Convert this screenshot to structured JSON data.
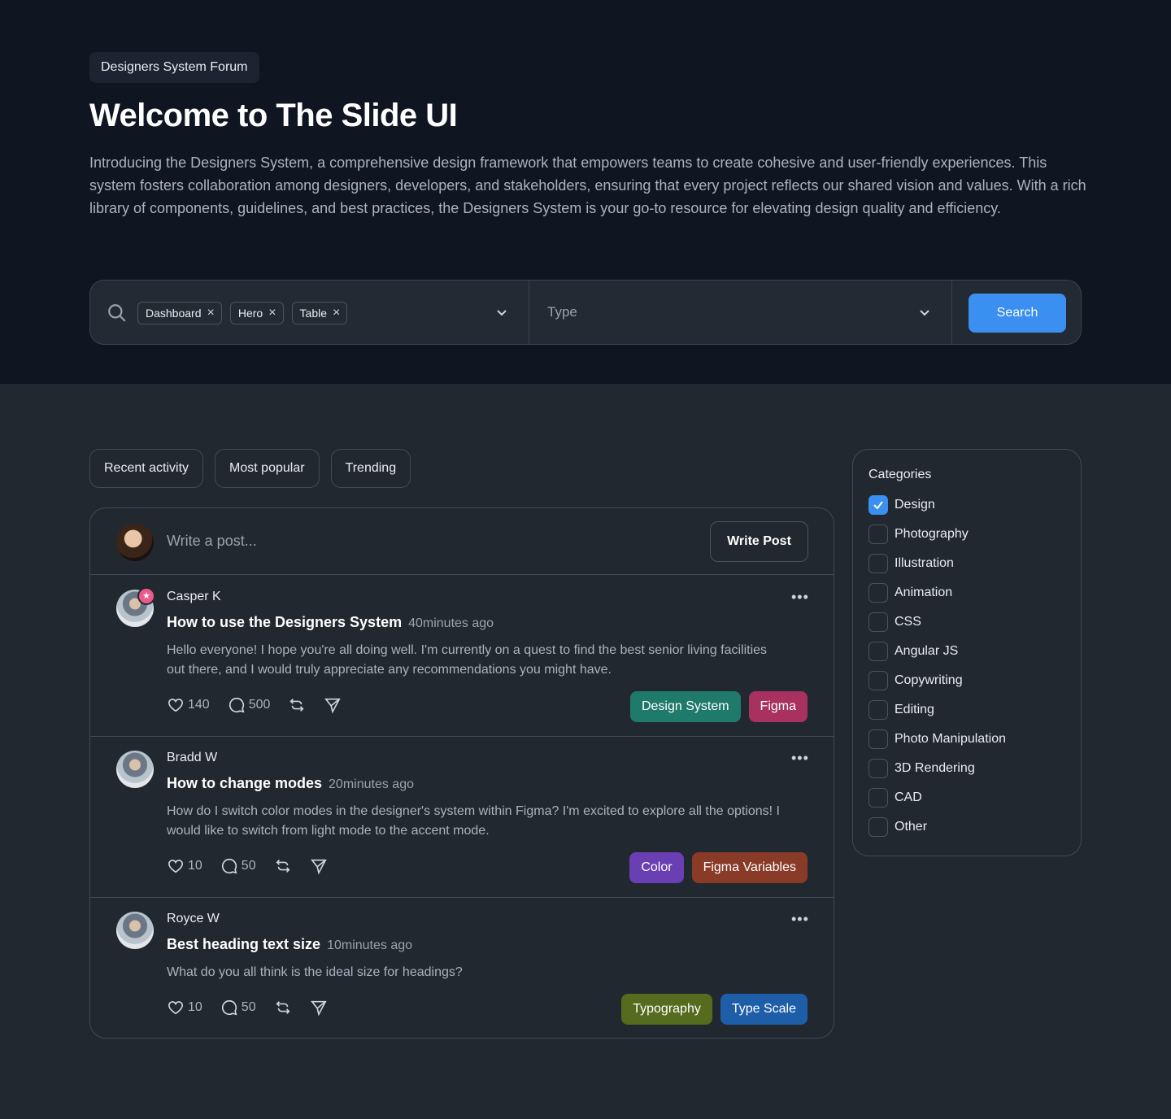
{
  "hero": {
    "pill": "Designers System Forum",
    "title": "Welcome to The Slide UI",
    "description": "Introducing the Designers System, a comprehensive design framework that empowers teams to create cohesive and user-friendly experiences. This system fosters collaboration among designers, developers, and stakeholders, ensuring that every project reflects our shared vision and values. With a rich library of components, guidelines, and best practices, the Designers System is your go-to resource for elevating design quality and efficiency."
  },
  "search": {
    "chips": [
      "Dashboard",
      "Hero",
      "Table"
    ],
    "type_placeholder": "Type",
    "button": "Search"
  },
  "tabs": [
    "Recent activity",
    "Most popular",
    "Trending"
  ],
  "composer": {
    "placeholder": "Write a post...",
    "button": "Write Post"
  },
  "posts": [
    {
      "author": "Casper K",
      "title": "How to use the Designers System",
      "time": "40minutes ago",
      "body": "Hello everyone! I hope you're all doing well. I'm currently on a quest to find the best senior living facilities out there, and I would truly appreciate any recommendations you might have.",
      "likes": "140",
      "comments": "500",
      "tags": [
        {
          "label": "Design System",
          "color": "#1f7a6b"
        },
        {
          "label": "Figma",
          "color": "#a8315f"
        }
      ]
    },
    {
      "author": "Bradd W",
      "title": "How to change modes",
      "time": "20minutes ago",
      "body": "How do I switch color modes in the designer's system within Figma? I'm excited to explore all the options! I would like to switch from light mode to the accent mode.",
      "likes": "10",
      "comments": "50",
      "tags": [
        {
          "label": "Color",
          "color": "#6a3fb3"
        },
        {
          "label": "Figma Variables",
          "color": "#8a3b28"
        }
      ]
    },
    {
      "author": "Royce W",
      "title": "Best heading text size",
      "time": "10minutes ago",
      "body": "What do you all think is the ideal size for headings?",
      "likes": "10",
      "comments": "50",
      "tags": [
        {
          "label": "Typography",
          "color": "#556b1e"
        },
        {
          "label": "Type Scale",
          "color": "#1e5ea8"
        }
      ]
    }
  ],
  "categories": {
    "title": "Categories",
    "items": [
      {
        "label": "Design",
        "checked": true
      },
      {
        "label": "Photography",
        "checked": false
      },
      {
        "label": "Illustration",
        "checked": false
      },
      {
        "label": "Animation",
        "checked": false
      },
      {
        "label": "CSS",
        "checked": false
      },
      {
        "label": "Angular JS",
        "checked": false
      },
      {
        "label": "Copywriting",
        "checked": false
      },
      {
        "label": "Editing",
        "checked": false
      },
      {
        "label": "Photo Manipulation",
        "checked": false
      },
      {
        "label": "3D Rendering",
        "checked": false
      },
      {
        "label": "CAD",
        "checked": false
      },
      {
        "label": "Other",
        "checked": false
      }
    ]
  },
  "colors": {
    "accent": "#3a8ff0",
    "hero_bg": "#0f1621",
    "page_bg": "#212830"
  }
}
